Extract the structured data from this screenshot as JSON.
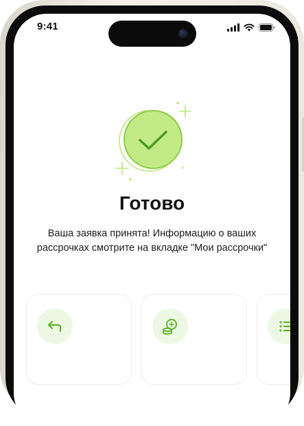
{
  "status_bar": {
    "time": "9:41"
  },
  "title": "Готово",
  "message": "Ваша заявка принята! Информацию о ваших рассрочках смотрите на вкладке \"Мои рассрочки\"",
  "accent_color": "#b9e67a",
  "cards": [
    {
      "icon": "return-arrow-icon"
    },
    {
      "icon": "coins-icon"
    },
    {
      "icon": "list-icon"
    }
  ]
}
